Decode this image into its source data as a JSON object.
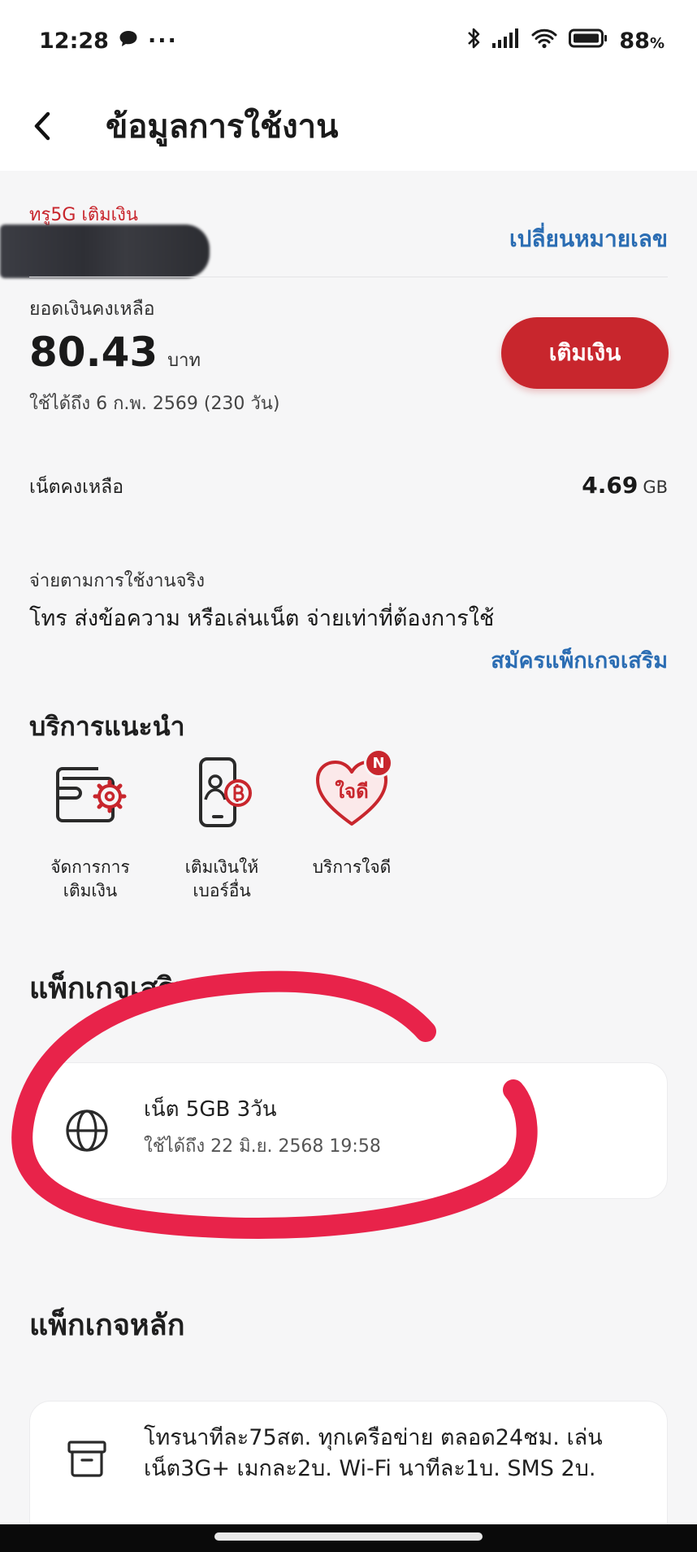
{
  "status_bar": {
    "time": "12:28",
    "more": "···",
    "battery": "88",
    "battery_unit": "%",
    "icons": [
      "chat-bubble-icon",
      "bluetooth-icon",
      "signal-icon",
      "wifi-icon",
      "battery-icon"
    ]
  },
  "header": {
    "title": "ข้อมูลการใช้งาน"
  },
  "account": {
    "plan_name": "ทรู5G เติมเงิน",
    "change_number": "เปลี่ยนหมายเลข"
  },
  "balance": {
    "label": "ยอดเงินคงเหลือ",
    "value": "80.43",
    "unit": "บาท",
    "valid_until": "ใช้ได้ถึง 6 ก.พ. 2569 (230 วัน)",
    "topup_button": "เติมเงิน"
  },
  "data": {
    "label": "เน็ตคงเหลือ",
    "value": "4.69",
    "unit": "GB"
  },
  "pay_as_you_go": {
    "label": "จ่ายตามการใช้งานจริง",
    "description": "โทร ส่งข้อความ หรือเล่นเน็ต จ่ายเท่าที่ต้องการใช้",
    "addon_link": "สมัครแพ็กเกจเสริม"
  },
  "recommended": {
    "title": "บริการแนะนำ",
    "items": [
      {
        "line1": "จัดการการ",
        "line2": "เติมเงิน",
        "icon": "wallet-gear-icon"
      },
      {
        "line1": "เติมเงินให้",
        "line2": "เบอร์อื่น",
        "icon": "phone-baht-icon"
      },
      {
        "line1": "บริการใจดี",
        "line2": "",
        "icon": "jaidee-heart-icon",
        "badge": "N",
        "icon_text": "ใจดี"
      }
    ]
  },
  "addon_packages": {
    "title": "แพ็กเกจเสริม",
    "items": [
      {
        "name": "เน็ต 5GB 3วัน",
        "valid_until": "ใช้ได้ถึง 22 มิ.ย. 2568 19:58",
        "icon": "globe-icon"
      }
    ]
  },
  "main_packages": {
    "title": "แพ็กเกจหลัก",
    "items": [
      {
        "description": "โทรนาทีละ75สต. ทุกเครือข่าย ตลอด24ชม. เล่นเน็ต3G+ เมกละ2บ. Wi-Fi นาทีละ1บ. SMS 2บ.",
        "icon": "archive-box-icon"
      }
    ]
  },
  "colors": {
    "brand_red": "#c8262d",
    "link_blue": "#2b6db3",
    "annotation_red": "#e8234a"
  }
}
